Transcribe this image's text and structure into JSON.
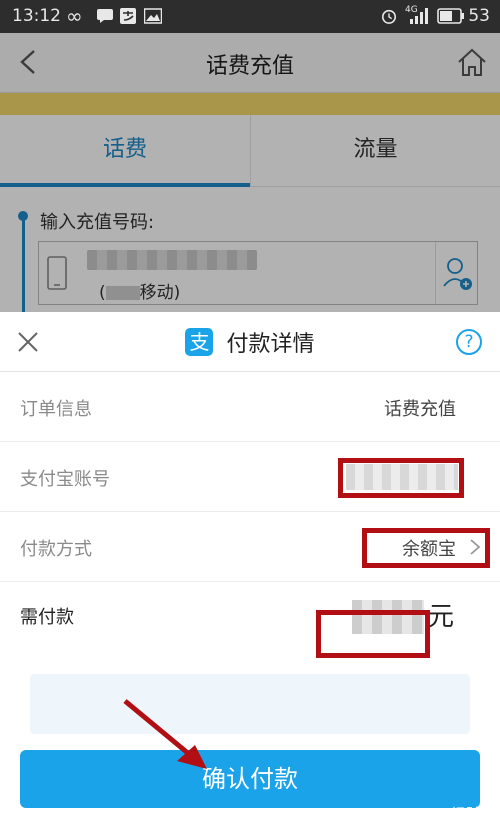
{
  "status_bar": {
    "time": "13:12",
    "infinity": "∞",
    "battery": "53",
    "network": "4G"
  },
  "background_page": {
    "nav_title": "话费充值",
    "tabs": [
      {
        "label": "话费"
      },
      {
        "label": "流量"
      }
    ],
    "recharge_label": "输入充值号码:",
    "carrier_text": "移动)"
  },
  "sheet": {
    "title": "付款详情",
    "logo_glyph": "支",
    "help_glyph": "?",
    "rows": [
      {
        "label": "订单信息",
        "value": "话费充值"
      },
      {
        "label": "支付宝账号",
        "value": ""
      },
      {
        "label": "付款方式",
        "value": "余额宝"
      },
      {
        "label": "需付款",
        "unit": "元"
      }
    ],
    "confirm_label": "确认付款"
  },
  "watermark": "Bai 经验",
  "colors": {
    "accent": "#1aa3e8",
    "tab_active": "#1e88c8",
    "highlight_frame": "#b10f13",
    "status_bar": "#2d2d2d"
  }
}
